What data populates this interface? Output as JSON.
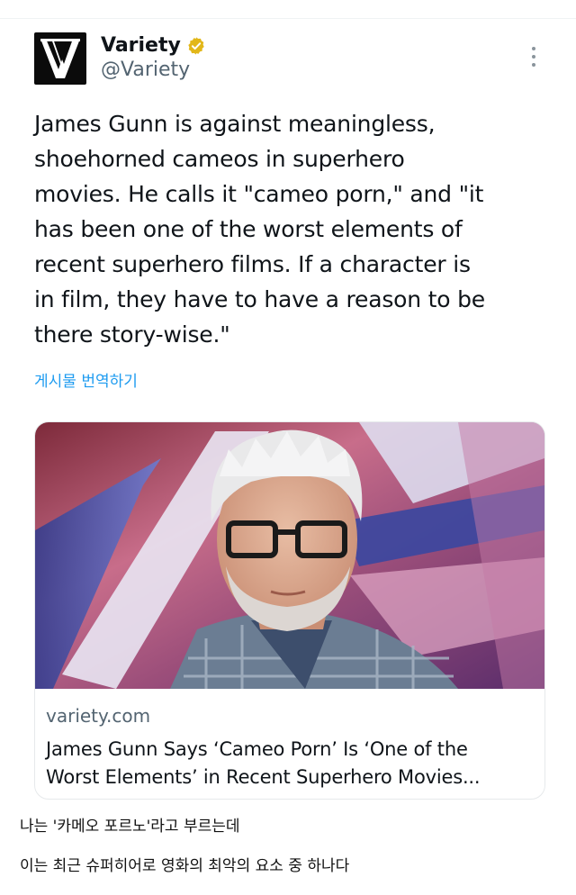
{
  "tweet": {
    "display_name": "Variety",
    "handle": "@Variety",
    "verified": true,
    "avatar_icon": "variety-v-logo",
    "more_icon": "vertical-ellipsis-icon",
    "text": "James Gunn is against meaningless,\nshoehorned  cameos in superhero\nmovies. He calls it \"cameo porn,\" and \"it\nhas been one of the worst elements of\nrecent superhero films. If a character is\nin film, they have to have a reason to be\nthere story-wise.\"",
    "translate_label": "게시물 번역하기"
  },
  "link_card": {
    "image_description": "photo-person",
    "domain": "variety.com",
    "title": "James Gunn Says ‘Cameo Porn’ Is ‘One of the\nWorst Elements’ in Recent Superhero Movies..."
  },
  "caption": {
    "line1": "나는 '카메오 포르노'라고 부르는데",
    "line2": "이는 최근 슈퍼히어로 영화의 최악의 요소 중 하나다"
  },
  "colors": {
    "link_blue": "#1d9bf0",
    "verified_gold": "#e2b719",
    "muted_text": "#536471"
  }
}
